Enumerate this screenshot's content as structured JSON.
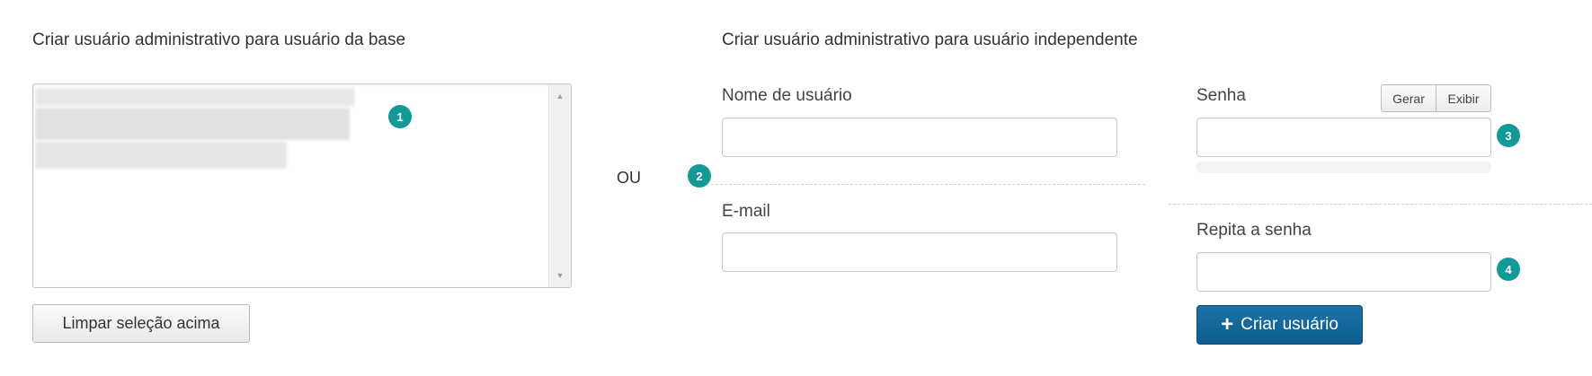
{
  "left": {
    "heading": "Criar usuário administrativo para usuário da base",
    "clear_button": "Limpar seleção acima"
  },
  "separator": {
    "or_label": "OU"
  },
  "right": {
    "heading": "Criar usuário administrativo para usuário independente",
    "username_label": "Nome de usuário",
    "email_label": "E-mail",
    "password_label": "Senha",
    "generate_button": "Gerar",
    "show_button": "Exibir",
    "repeat_password_label": "Repita a senha",
    "create_button": "Criar usuário"
  },
  "badges": [
    "1",
    "2",
    "3",
    "4"
  ],
  "colors": {
    "badge": "#139a98",
    "primary": "#13679c"
  },
  "icons": {
    "plus": "plus-icon",
    "scroll_up": "scroll-up-arrow-icon",
    "scroll_down": "scroll-down-arrow-icon"
  }
}
